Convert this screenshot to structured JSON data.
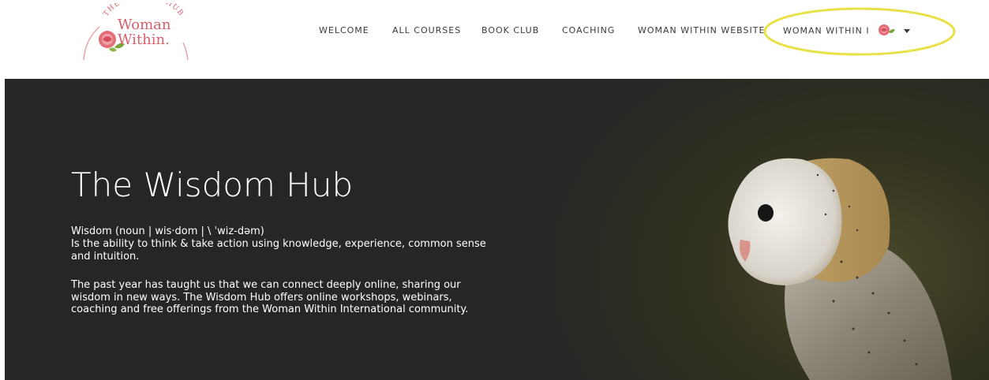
{
  "logo": {
    "arc_text": "THE WISDOM HUB",
    "line1": "Woman",
    "line2": "Within."
  },
  "nav": {
    "items": [
      {
        "label": "WELCOME"
      },
      {
        "label": "ALL COURSES"
      },
      {
        "label": "BOOK CLUB"
      },
      {
        "label": "COACHING"
      },
      {
        "label": "WOMAN WITHIN WEBSITE"
      }
    ],
    "dropdown_label": "WOMAN WITHIN I",
    "dropdown_icon": "rose-logo-icon"
  },
  "hero": {
    "title": "The Wisdom Hub",
    "definition_line1": "Wisdom (noun | wis·dom | \\ ˈwiz-dəm)",
    "definition_line2": "Is the ability to think & take action using knowledge, experience, common sense and intuition.",
    "paragraph": "The past year has taught us that we can connect deeply online, sharing our wisdom in new ways. The Wisdom Hub offers online workshops, webinars, coaching and free offerings from the Woman Within International community."
  },
  "colors": {
    "brand_pink": "#d85f6c",
    "highlight": "#e8e24a",
    "hero_bg": "#262626"
  }
}
